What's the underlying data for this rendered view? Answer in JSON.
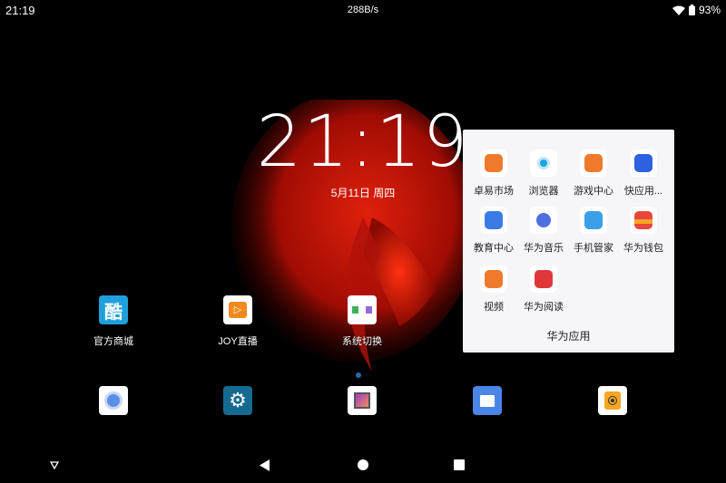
{
  "status_bar": {
    "time": "21:19",
    "net_speed": "288B/s",
    "battery": "93%",
    "wifi_icon": "wifi-icon",
    "battery_icon": "battery-icon"
  },
  "lock_clock": {
    "time": "21:19",
    "date": "5月11日 周四"
  },
  "home_apps": [
    {
      "label": "官方商城",
      "color": "#1ea0dc"
    },
    {
      "label": "JOY直播",
      "color": "#f08a1e"
    },
    {
      "label": "系统切换",
      "color": "#ffffff"
    }
  ],
  "folder": {
    "title": "华为应用",
    "apps": [
      {
        "label": "卓易市场",
        "color": "#f07a2c"
      },
      {
        "label": "浏览器",
        "color": "#1aa5e0"
      },
      {
        "label": "游戏中心",
        "color": "#f07a2c"
      },
      {
        "label": "快应用...",
        "color": "#2f62e0"
      },
      {
        "label": "教育中心",
        "color": "#3b7be6"
      },
      {
        "label": "华为音乐",
        "color": "#4f6fe0"
      },
      {
        "label": "手机管家",
        "color": "#3aa0e8"
      },
      {
        "label": "华为钱包",
        "color": "#e8463c"
      },
      {
        "label": "视频",
        "color": "#f07a2c"
      },
      {
        "label": "华为阅读",
        "color": "#e0383a"
      }
    ]
  },
  "dock": [
    "chromium",
    "settings",
    "gallery",
    "files",
    "music"
  ],
  "colors": {
    "page_indicator": "#1e6fa8",
    "folder_bg": "#f6f6f8"
  }
}
